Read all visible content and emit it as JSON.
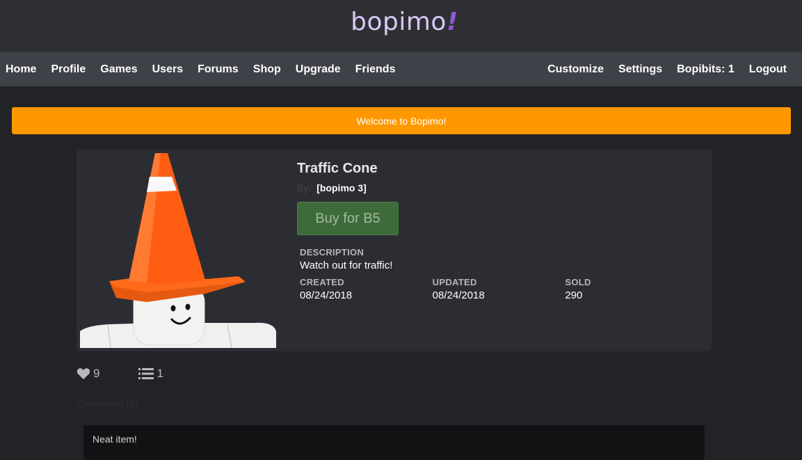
{
  "header": {
    "logo_text": "bopimo",
    "logo_mark": "!"
  },
  "nav": {
    "left": [
      {
        "label": "Home"
      },
      {
        "label": "Profile"
      },
      {
        "label": "Games"
      },
      {
        "label": "Users"
      },
      {
        "label": "Forums"
      },
      {
        "label": "Shop"
      },
      {
        "label": "Upgrade"
      },
      {
        "label": "Friends"
      }
    ],
    "right": [
      {
        "label": "Customize"
      },
      {
        "label": "Settings"
      },
      {
        "label": "Bopibits: 1"
      },
      {
        "label": "Logout"
      }
    ]
  },
  "banner": {
    "text": "Welcome to Bopimo!"
  },
  "item": {
    "title": "Traffic Cone",
    "by_label": "By:",
    "creator": "[bopimo 3]",
    "buy_label": "Buy for B5",
    "description_label": "DESCRIPTION",
    "description": "Watch out for traffic!",
    "created_label": "CREATED",
    "created": "08/24/2018",
    "updated_label": "UPDATED",
    "updated": "08/24/2018",
    "sold_label": "SOLD",
    "sold": "290"
  },
  "social": {
    "favorites": "9",
    "lists": "1"
  },
  "comments_label": "Comments (1)",
  "comments": [
    {
      "text": "Neat item!"
    }
  ],
  "colors": {
    "banner": "#ff9800",
    "buy_button": "#3e6b3a",
    "logo": "#d9c8f5",
    "logo_mark": "#8b59d6"
  },
  "icons": {
    "favorite": "heart-icon",
    "list": "list-icon"
  }
}
